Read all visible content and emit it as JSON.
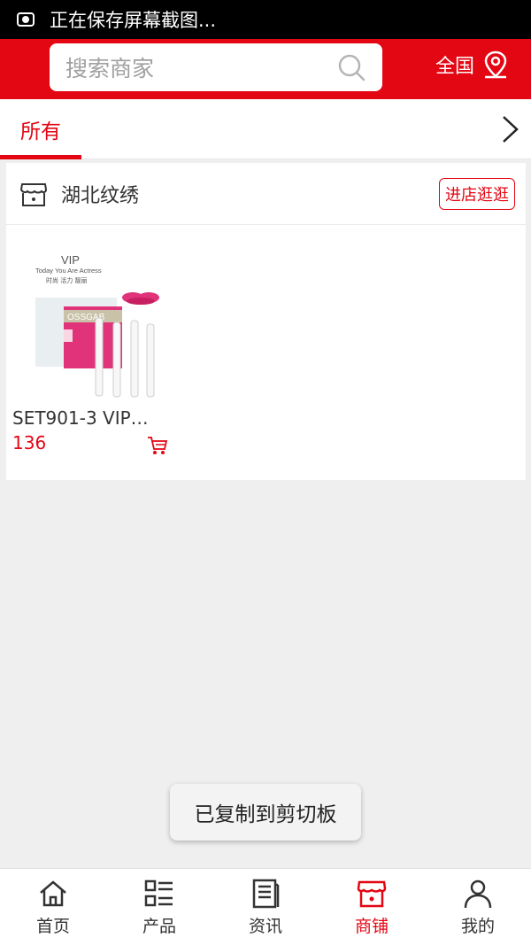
{
  "status_bar": {
    "text": "正在保存屏幕截图..."
  },
  "header": {
    "search_placeholder": "搜索商家",
    "region_label": "全国"
  },
  "tabs": {
    "active_label": "所有"
  },
  "shop": {
    "name": "湖北纹绣",
    "enter_label": "进店逛逛",
    "products": [
      {
        "title": "SET901-3 VIP…",
        "price": "136"
      }
    ]
  },
  "thumb_text": {
    "vip": "VIP",
    "tagline": "Today You Are Actress",
    "chinese": "时尚 活力 靓丽",
    "brand": "OSSGAB"
  },
  "toast": "已复制到剪切板",
  "tabbar": {
    "items": [
      {
        "label": "首页",
        "icon": "home-icon"
      },
      {
        "label": "产品",
        "icon": "product-list-icon"
      },
      {
        "label": "资讯",
        "icon": "news-icon"
      },
      {
        "label": "商铺",
        "icon": "shop-icon"
      },
      {
        "label": "我的",
        "icon": "user-icon"
      }
    ],
    "active_index": 3
  },
  "colors": {
    "brand": "#e30613",
    "background": "#efefef"
  }
}
